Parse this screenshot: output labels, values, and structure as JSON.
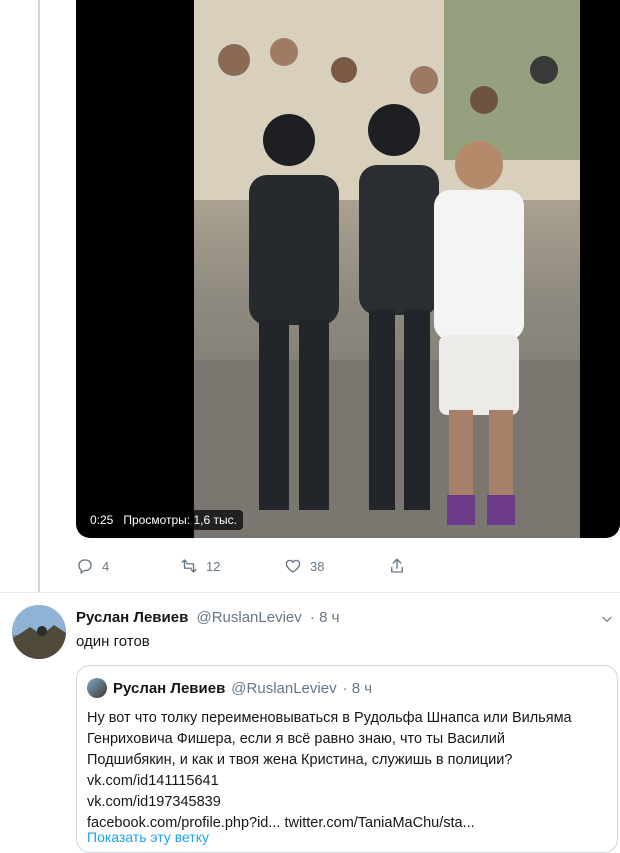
{
  "video": {
    "duration": "0:25",
    "views": "Просмотры: 1,6 тыс."
  },
  "actions": {
    "reply_count": "4",
    "retweet_count": "12",
    "like_count": "38"
  },
  "tweet": {
    "author_name": "Руслан Левиев",
    "author_handle": "@RuslanLeviev",
    "time": "· 8 ч",
    "text": "один готов"
  },
  "quoted": {
    "author_name": "Руслан Левиев",
    "author_handle": "@RuslanLeviev",
    "time": "· 8 ч",
    "lines": [
      "Ну вот что толку переименовываться в Рудольфа Шнапса или Вильяма",
      "Генриховича Фишера, если я всё равно знаю, что ты Василий",
      "Подшибякин, и как и твоя жена Кристина, служишь в полиции?",
      "vk.com/id141115641",
      "vk.com/id197345839",
      "facebook.com/profile.php?id... twitter.com/TaniaMaChu/sta..."
    ],
    "show_thread": "Показать эту ветку"
  },
  "colors": {
    "accent": "#1da1f2",
    "muted": "#657786",
    "border": "#ccd6dd"
  },
  "icons": [
    "reply-icon",
    "retweet-icon",
    "like-icon",
    "share-icon",
    "caret-down-icon"
  ]
}
